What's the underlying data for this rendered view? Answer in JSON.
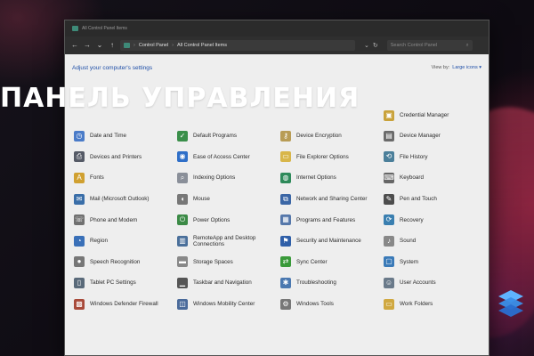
{
  "banner": {
    "title": "ПАНЕЛЬ УПРАВЛЕНИЯ"
  },
  "window": {
    "title": "All Control Panel Items"
  },
  "addressbar": {
    "segments": [
      "Control Panel",
      "All Control Panel Items"
    ],
    "search_placeholder": "Search Control Panel"
  },
  "header": {
    "adjust_text": "Adjust your computer's settings",
    "view_by_label": "View by:",
    "view_by_value": "Large icons ▾"
  },
  "items": [
    {
      "label": "Credential Manager",
      "icon": "credential-icon",
      "color": "#c9a23a"
    },
    {
      "label": "Date and Time",
      "icon": "clock-icon",
      "color": "#4a7bc8"
    },
    {
      "label": "Default Programs",
      "icon": "default-programs-icon",
      "color": "#3a8f4a"
    },
    {
      "label": "Device Encryption",
      "icon": "key-icon",
      "color": "#b89c55"
    },
    {
      "label": "Device Manager",
      "icon": "device-manager-icon",
      "color": "#6a6a6a"
    },
    {
      "label": "Devices and Printers",
      "icon": "printer-icon",
      "color": "#555a66"
    },
    {
      "label": "Ease of Access Center",
      "icon": "ease-access-icon",
      "color": "#2f6fc8"
    },
    {
      "label": "File Explorer Options",
      "icon": "folder-icon",
      "color": "#d8b64a"
    },
    {
      "label": "File History",
      "icon": "file-history-icon",
      "color": "#4b7f9a"
    },
    {
      "label": "Fonts",
      "icon": "fonts-icon",
      "color": "#d0a030"
    },
    {
      "label": "Indexing Options",
      "icon": "indexing-icon",
      "color": "#8a8f99"
    },
    {
      "label": "Internet Options",
      "icon": "globe-icon",
      "color": "#2e8a5a"
    },
    {
      "label": "Keyboard",
      "icon": "keyboard-icon",
      "color": "#666666"
    },
    {
      "label": "Mail (Microsoft Outlook)",
      "icon": "mail-icon",
      "color": "#3a6ea8"
    },
    {
      "label": "Mouse",
      "icon": "mouse-icon",
      "color": "#777777"
    },
    {
      "label": "Network and Sharing Center",
      "icon": "network-icon",
      "color": "#3b66a5"
    },
    {
      "label": "Pen and Touch",
      "icon": "pen-icon",
      "color": "#4d4d4d"
    },
    {
      "label": "Phone and Modem",
      "icon": "phone-icon",
      "color": "#707070"
    },
    {
      "label": "Power Options",
      "icon": "power-icon",
      "color": "#3b8a46"
    },
    {
      "label": "Programs and Features",
      "icon": "programs-icon",
      "color": "#5577aa"
    },
    {
      "label": "Recovery",
      "icon": "recovery-icon",
      "color": "#3a7fb0"
    },
    {
      "label": "Region",
      "icon": "region-icon",
      "color": "#3a70b8"
    },
    {
      "label": "RemoteApp and Desktop Connections",
      "icon": "remoteapp-icon",
      "color": "#4a6f9a"
    },
    {
      "label": "Security and Maintenance",
      "icon": "flag-icon",
      "color": "#2f5fa8"
    },
    {
      "label": "Sound",
      "icon": "sound-icon",
      "color": "#888888"
    },
    {
      "label": "Speech Recognition",
      "icon": "microphone-icon",
      "color": "#777777"
    },
    {
      "label": "Storage Spaces",
      "icon": "storage-icon",
      "color": "#888888"
    },
    {
      "label": "Sync Center",
      "icon": "sync-icon",
      "color": "#3a9a3a"
    },
    {
      "label": "System",
      "icon": "system-icon",
      "color": "#3a7ab8"
    },
    {
      "label": "Tablet PC Settings",
      "icon": "tablet-icon",
      "color": "#5a6a7a"
    },
    {
      "label": "Taskbar and Navigation",
      "icon": "taskbar-icon",
      "color": "#555555"
    },
    {
      "label": "Troubleshooting",
      "icon": "troubleshoot-icon",
      "color": "#4a78b0"
    },
    {
      "label": "User Accounts",
      "icon": "users-icon",
      "color": "#6a7a8a"
    },
    {
      "label": "Windows Defender Firewall",
      "icon": "firewall-icon",
      "color": "#a84a3a"
    },
    {
      "label": "Windows Mobility Center",
      "icon": "mobility-icon",
      "color": "#4a6a9a"
    },
    {
      "label": "Windows Tools",
      "icon": "tools-icon",
      "color": "#777777"
    },
    {
      "label": "Work Folders",
      "icon": "work-folders-icon",
      "color": "#d0a840"
    }
  ]
}
